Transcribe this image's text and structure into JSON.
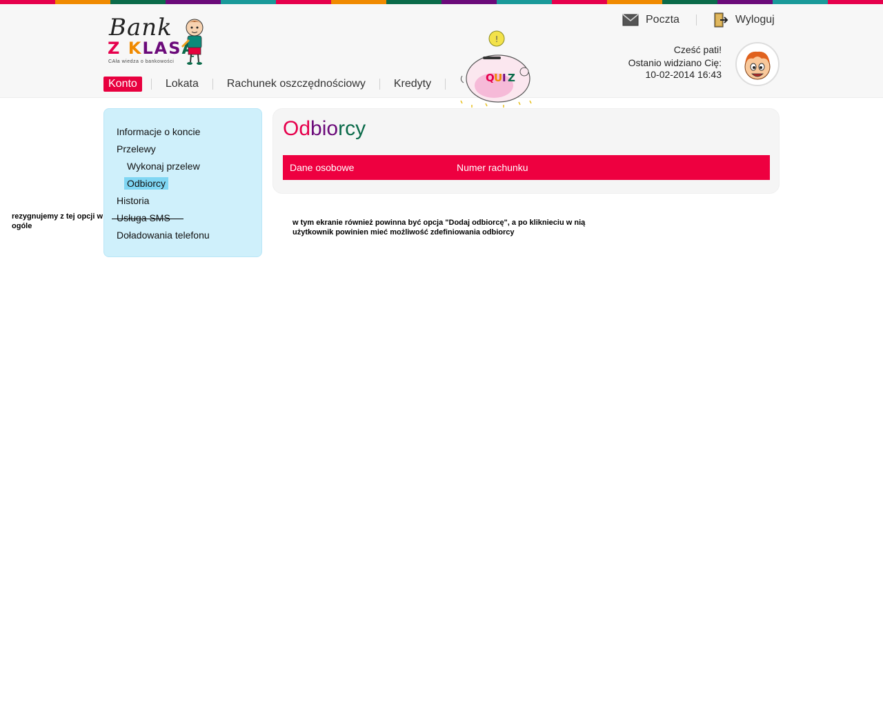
{
  "stripe_colors": [
    "#e6004c",
    "#f08a00",
    "#0b6b4a",
    "#6b0a7a",
    "#1a9a9a",
    "#e6004c",
    "#f08a00",
    "#0b6b4a",
    "#6b0a7a",
    "#1a9a9a",
    "#e6004c",
    "#f08a00",
    "#0b6b4a",
    "#6b0a7a",
    "#1a9a9a",
    "#e6004c"
  ],
  "logo": {
    "line1": "Bank",
    "line2_parts": [
      "Z",
      " K",
      "LAS",
      "Ą"
    ],
    "tagline": "CAła wiedza o bankowości"
  },
  "nav": {
    "items": [
      {
        "label": "Konto",
        "active": true
      },
      {
        "label": "Lokata",
        "active": false
      },
      {
        "label": "Rachunek oszczędnościowy",
        "active": false
      },
      {
        "label": "Kredyty",
        "active": false
      }
    ]
  },
  "quiz": {
    "label": "QUIZ"
  },
  "toplinks": {
    "mail_label": "Poczta",
    "logout_label": "Wyloguj"
  },
  "user": {
    "greeting": "Cześć pati!",
    "last_seen_label": "Ostanio widziano Cię:",
    "last_seen_value": "10-02-2014 16:43"
  },
  "sidebar": {
    "items": [
      {
        "label": "Informacje o koncie",
        "level": 0
      },
      {
        "label": "Przelewy",
        "level": 0
      },
      {
        "label": "Wykonaj przelew",
        "level": 1
      },
      {
        "label": "Odbiorcy",
        "level": 1,
        "active": true
      },
      {
        "label": "Historia",
        "level": 0
      },
      {
        "label": "Usługa SMS",
        "level": 0,
        "strikethrough": true
      },
      {
        "label": "Doładowania telefonu",
        "level": 0
      }
    ]
  },
  "annotations": {
    "left_note": "rezygnujemy z tej opcji w ogóle",
    "main_note": "w tym ekranie również powinna być opcja \"Dodaj odbiorcę\", a po kliknieciu w nią użytkownik powinien mieć możliwość zdefiniowania odbiorcy"
  },
  "main": {
    "title_parts": [
      "Od",
      "bio",
      "rcy"
    ],
    "table": {
      "headers": [
        "Dane osobowe",
        "Numer rachunku"
      ]
    }
  }
}
